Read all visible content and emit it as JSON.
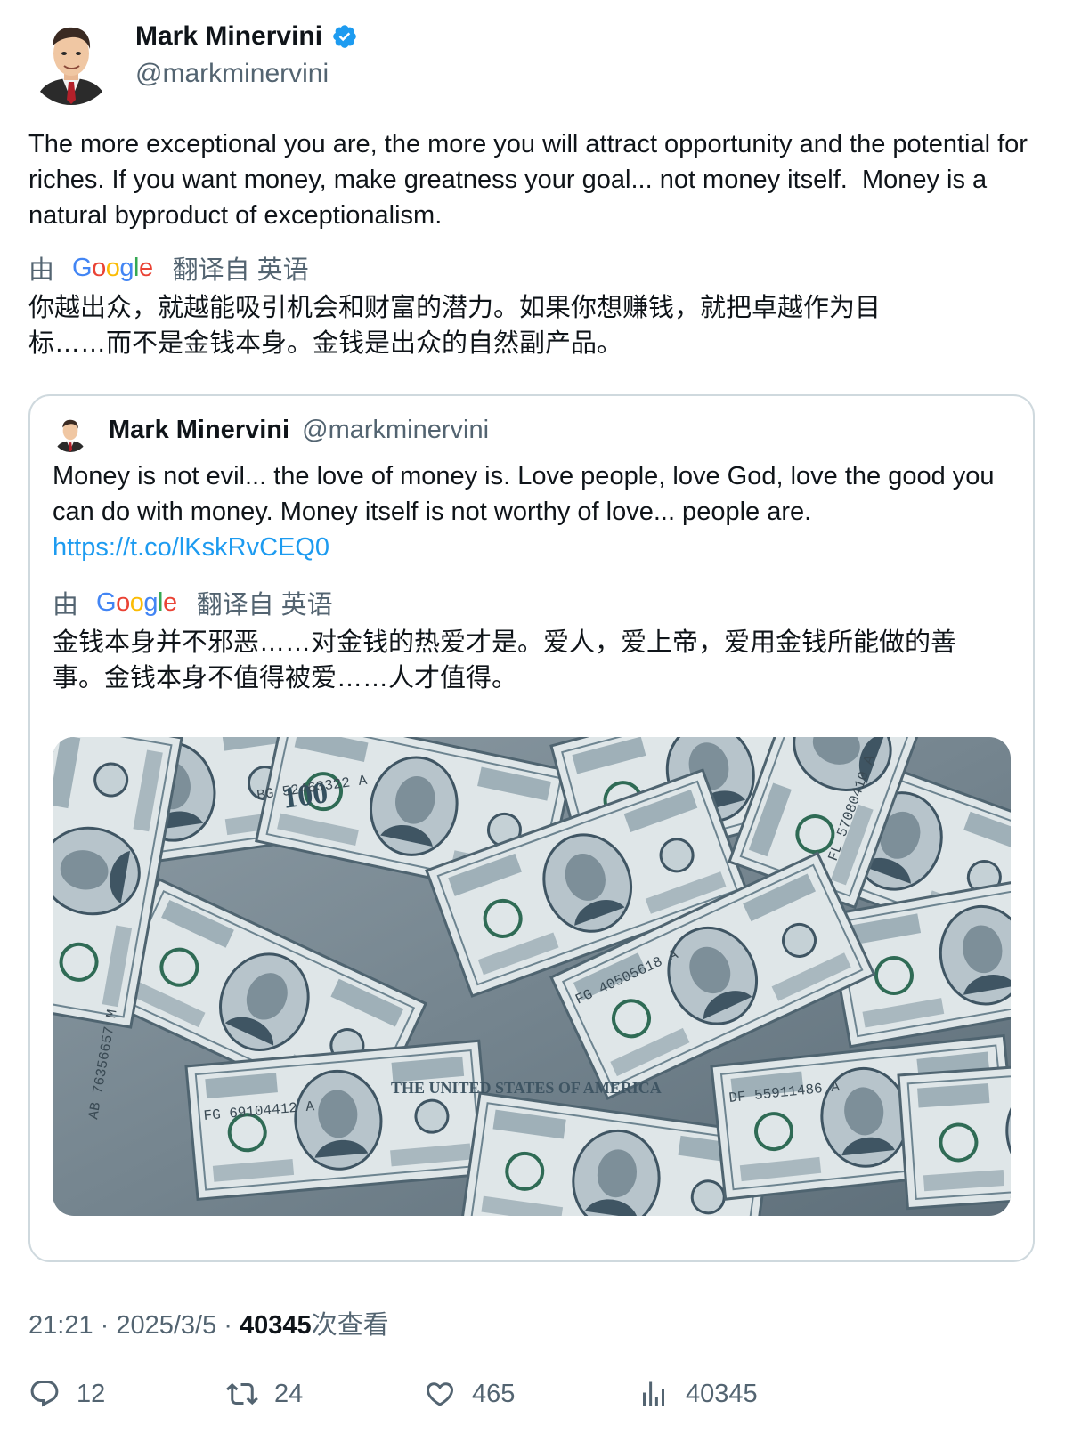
{
  "author": {
    "name": "Mark Minervini",
    "handle": "@markminervini"
  },
  "tweet": {
    "text": "The more exceptional you are, the more you will attract opportunity and the potential for riches. If you want money, make greatness your goal... not money itself.  Money is a natural byproduct of exceptionalism.",
    "translate_prefix": "由",
    "translate_suffix": "翻译自 英语",
    "translated_text": "你越出众，就越能吸引机会和财富的潜力。如果你想赚钱，就把卓越作为目标……而不是金钱本身。金钱是出众的自然副产品。"
  },
  "quote": {
    "name": "Mark Minervini",
    "handle": "@markminervini",
    "text": "Money is not evil... the love of money is. Love people, love God, love the good you can do with money. Money itself is not worthy of love... people are. ",
    "link": "https://t.co/lKskRvCEQ0",
    "translate_prefix": "由",
    "translate_suffix": "翻译自 英语",
    "translated_text": "金钱本身并不邪恶……对金钱的热爱才是。爱人，爱上帝，爱用金钱所能做的善事。金钱本身不值得被爱……人才值得。",
    "media": {
      "bill_denomination": "100",
      "serials": [
        "BG 52463322 A",
        "FL 57080410 A",
        "FG 40505618 A",
        "AB 76356657 M",
        "FG 69104412 A",
        "DF 55911486 A"
      ],
      "bill_header": "THE UNITED STATES OF AMERICA"
    }
  },
  "meta": {
    "time": "21:21",
    "separator": " · ",
    "date": "2025/3/5",
    "views_count": "40345",
    "views_label": "次查看"
  },
  "actions": {
    "replies": "12",
    "retweets": "24",
    "likes": "465",
    "views": "40345"
  },
  "colors": {
    "link": "#1d9bf0",
    "verified": "#1d9bf0",
    "muted": "#536471",
    "border": "#cfd9de"
  }
}
